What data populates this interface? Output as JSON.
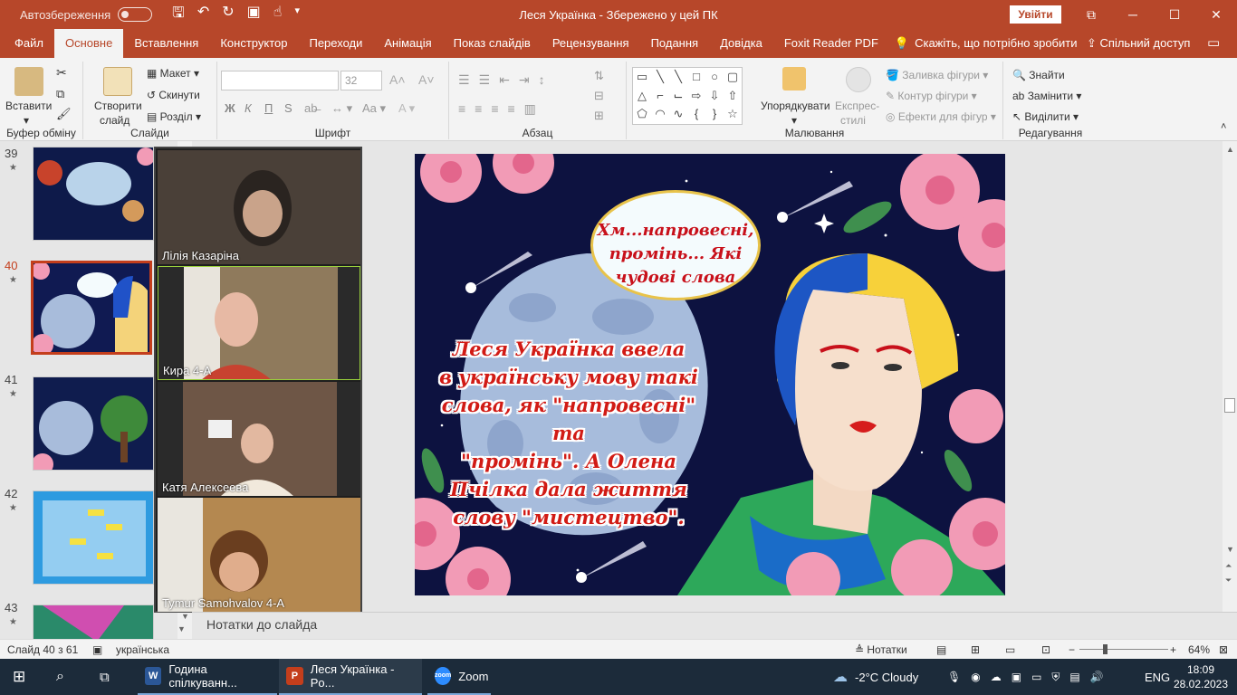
{
  "titlebar": {
    "autosave_label": "Автозбереження",
    "document_title": "Леся Українка  -  Збережено у цей ПК",
    "signin_label": "Увійти",
    "window_buttons": [
      "⧉",
      "─",
      "☐",
      "✕"
    ]
  },
  "tabs": [
    "Файл",
    "Основне",
    "Вставлення",
    "Конструктор",
    "Переходи",
    "Анімація",
    "Показ слайдів",
    "Рецензування",
    "Подання",
    "Довідка",
    "Foxit Reader PDF"
  ],
  "tell_me": "Скажіть, що потрібно зробити",
  "share_label": "Спільний доступ",
  "ribbon": {
    "paste_label": "Вставити",
    "clipboard_group": "Буфер обміну",
    "new_slide_label": "Створити",
    "new_slide_label2": "слайд",
    "layout_label": "Макет",
    "reset_label": "Скинути",
    "section_label": "Розділ",
    "slides_group": "Слайди",
    "font_size": "32",
    "font_group": "Шрифт",
    "paragraph_group": "Абзац",
    "arrange_label": "Упорядкувати",
    "quick_styles_label": "Експрес-",
    "quick_styles_label2": "стилі",
    "shape_fill": "Заливка фігури",
    "shape_outline": "Контур фігури",
    "shape_effects": "Ефекти для фігур",
    "drawing_group": "Малювання",
    "find_label": "Знайти",
    "replace_label": "Замінити",
    "select_label": "Виділити",
    "editing_group": "Редагування",
    "bold": "Ж",
    "italic": "К",
    "underline": "П",
    "strike": "S"
  },
  "thumbnails": [
    {
      "num": "39",
      "bg": "#0e1a4a"
    },
    {
      "num": "40",
      "bg": "#101a52"
    },
    {
      "num": "41",
      "bg": "#0f1c4e"
    },
    {
      "num": "42",
      "bg": "#2e9be0"
    },
    {
      "num": "43",
      "bg": "#2a8a6a"
    }
  ],
  "zoom_participants": [
    {
      "name": "Лілія Казаріна",
      "bg": "#4a4038"
    },
    {
      "name": "Кира 4-А",
      "bg": "#8f7a5c"
    },
    {
      "name": "Катя Алексеева",
      "bg": "#6e5646"
    },
    {
      "name": "Tymur Samohvalov 4-A",
      "bg": "#b48850"
    }
  ],
  "slide": {
    "bubble_text": "Хм...напровесні, промінь... Які чудові слова",
    "main_text_lines": [
      "Леся Українка ввела",
      "в українську мову такі",
      "слова, як \"напровесні\" та",
      "\"промінь\". А Олена",
      "Пчілка дала життя",
      "слову \"мистецтво\"."
    ]
  },
  "notes_placeholder": "Нотатки до слайда",
  "status": {
    "slide_of": "Слайд 40 з 61",
    "language": "українська",
    "notes_label": "Нотатки",
    "zoom": "64%"
  },
  "taskbar": {
    "apps": [
      {
        "label": "Година спілкуванн...",
        "icon": "W",
        "color": "#2b5797"
      },
      {
        "label": "Леся Українка - Po...",
        "icon": "P",
        "color": "#c43e1c"
      },
      {
        "label": "Zoom",
        "icon": "zoom",
        "color": "#2d8cff"
      }
    ],
    "weather": "-2°C  Cloudy",
    "lang": "ENG",
    "time": "18:09",
    "date": "28.02.2023"
  }
}
